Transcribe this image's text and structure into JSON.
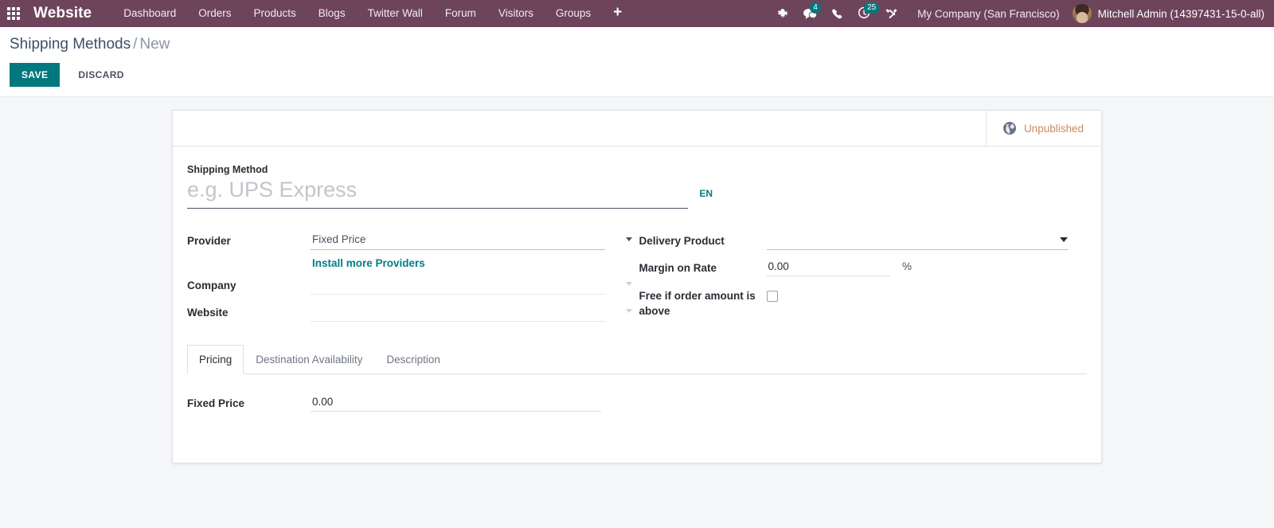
{
  "navbar": {
    "apps_icon": "apps-grid-icon",
    "brand": "Website",
    "menu": [
      {
        "label": "Dashboard"
      },
      {
        "label": "Orders"
      },
      {
        "label": "Products"
      },
      {
        "label": "Blogs"
      },
      {
        "label": "Twitter Wall"
      },
      {
        "label": "Forum"
      },
      {
        "label": "Visitors"
      },
      {
        "label": "Groups"
      }
    ],
    "add_label": "+",
    "systray": {
      "debug_icon": "bug-icon",
      "messages_icon": "chat-bubbles-icon",
      "messages_count": "4",
      "phone_icon": "phone-icon",
      "activities_icon": "clock-icon",
      "activities_count": "25",
      "tools_icon": "wrench-screwdriver-icon"
    },
    "company": "My Company (San Francisco)",
    "user_name": "Mitchell Admin (14397431-15-0-all)",
    "avatar": "user-avatar"
  },
  "control_panel": {
    "breadcrumb_parent": "Shipping Methods",
    "breadcrumb_separator": "/",
    "breadcrumb_current": "New",
    "save_label": "SAVE",
    "discard_label": "DISCARD"
  },
  "form": {
    "status": {
      "globe_icon": "globe-icon",
      "publish_state": "Unpublished"
    },
    "title_field": {
      "label": "Shipping Method",
      "value": "",
      "placeholder": "e.g. UPS Express",
      "lang": "EN"
    },
    "left_column": [
      {
        "label": "Provider",
        "value": "Fixed Price",
        "type": "select"
      },
      {
        "label": "Company",
        "value": "",
        "type": "select"
      },
      {
        "label": "Website",
        "value": "",
        "type": "select"
      }
    ],
    "install_link": "Install more Providers",
    "right_column": {
      "delivery_product": {
        "label": "Delivery Product",
        "value": ""
      },
      "margin_on_rate": {
        "label": "Margin on Rate",
        "value": "0.00",
        "suffix": "%"
      },
      "free_if_above": {
        "label": "Free if order amount is above",
        "checked": false
      }
    },
    "tabs": [
      {
        "label": "Pricing",
        "active": true
      },
      {
        "label": "Destination Availability",
        "active": false
      },
      {
        "label": "Description",
        "active": false
      }
    ],
    "pricing_tab": {
      "fixed_price": {
        "label": "Fixed Price",
        "value": "0.00"
      }
    }
  },
  "colors": {
    "navbar_bg": "#6d4459",
    "accent_teal": "#00787d",
    "unpublished": "#c98b5e",
    "page_bg": "#f5f6f8"
  }
}
